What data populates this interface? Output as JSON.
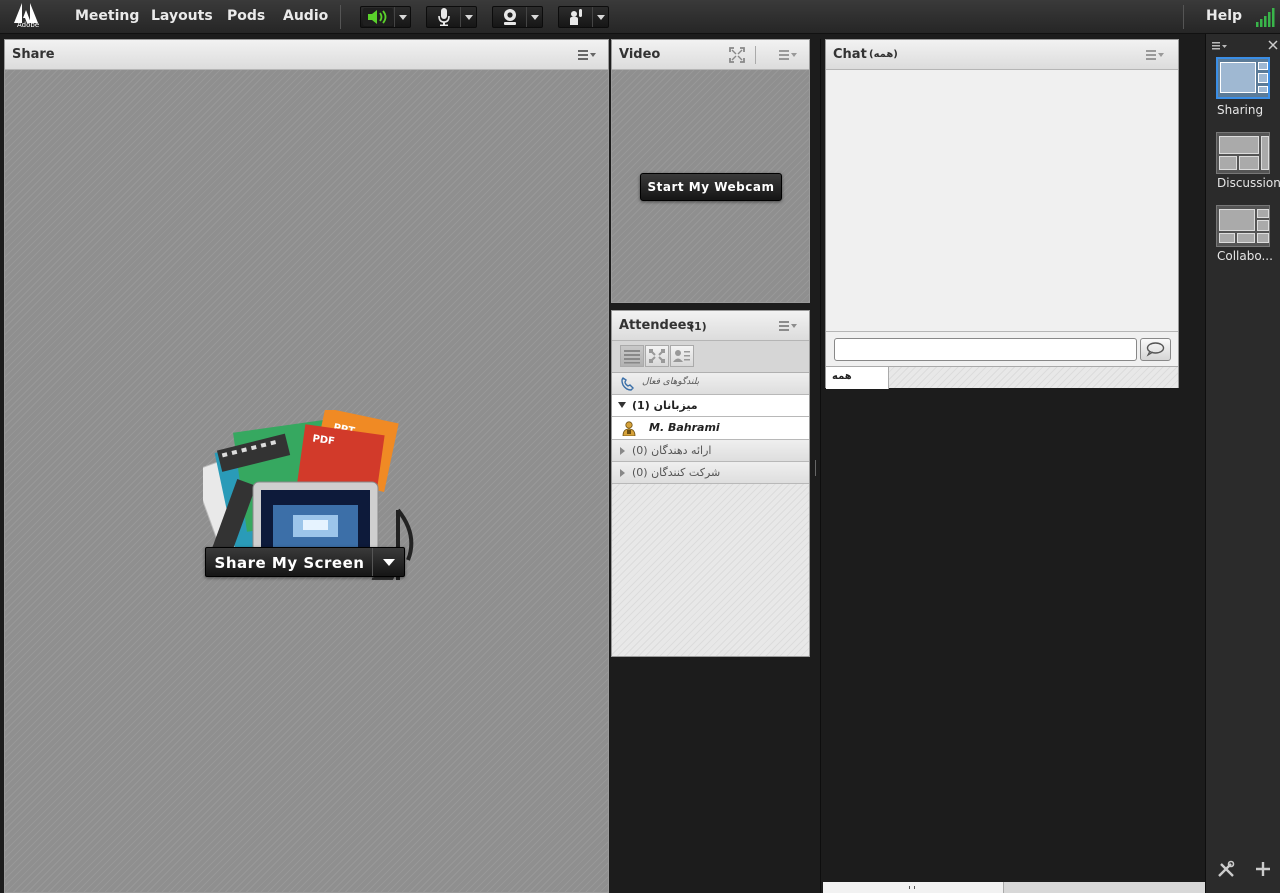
{
  "topbar": {
    "logo_text": "Adobe",
    "menu": [
      "Meeting",
      "Layouts",
      "Pods",
      "Audio"
    ],
    "help_label": "Help"
  },
  "share_pod": {
    "title": "Share",
    "share_button_label": "Share My Screen",
    "illustration_labels": [
      "PPT",
      "PDF"
    ]
  },
  "video_pod": {
    "title": "Video",
    "webcam_button_label": "Start My Webcam"
  },
  "attendees_pod": {
    "title": "Attendees",
    "count": "(1)",
    "rows": [
      {
        "label": "بلندگوهای فعال"
      },
      {
        "label": "میزبانان",
        "count": "(1)"
      },
      {
        "label": "M. Bahrami"
      },
      {
        "label": "ارائه دهندگان",
        "count": "(0)"
      },
      {
        "label": "شرکت کنندگان",
        "count": "(0)"
      }
    ]
  },
  "chat_pod": {
    "title": "Chat",
    "title_tag": "(همه)",
    "input_value": "",
    "tab_label": "همه"
  },
  "layouts_rail": {
    "items": [
      "Sharing",
      "Discussion",
      "Collabo..."
    ]
  },
  "colors": {
    "accent_active": "#3a8ee6",
    "speaker_green": "#5ad12b",
    "signal_green": "#39b54a"
  }
}
